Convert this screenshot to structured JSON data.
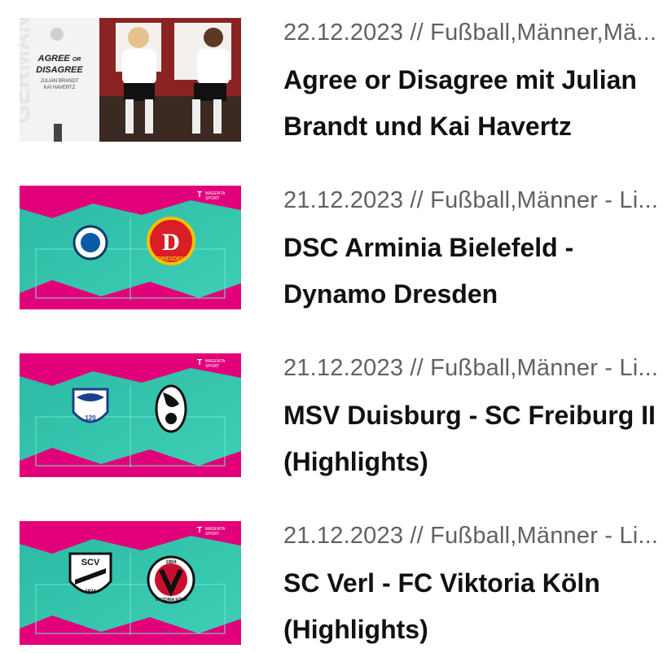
{
  "articles": [
    {
      "meta": "22.12.2023 // Fußball,Männer,Mä...",
      "title": "Agree or Disagree mit Julian Brandt und Kai Havertz",
      "thumb": {
        "type": "photo",
        "line1": "AGREE",
        "line1_small": "OR",
        "line2": "DISAGREE",
        "names1": "JULIAN BRANDT",
        "names2": "KAI HAVERTZ"
      }
    },
    {
      "meta": "21.12.2023 // Fußball,Männer - Li...",
      "title": "DSC Arminia Bielefeld - Dynamo Dresden",
      "thumb": {
        "type": "magenta",
        "brand1": "MAGENTA",
        "brand2": "SPORT",
        "right_logo_text": "DRESDEN",
        "right_logo_letter": "D"
      }
    },
    {
      "meta": "21.12.2023 // Fußball,Männer - Li...",
      "title": "MSV Duisburg - SC Freiburg II (Highlights)",
      "thumb": {
        "type": "magenta",
        "brand1": "MAGENTA",
        "brand2": "SPORT",
        "left_logo_text": "120"
      }
    },
    {
      "meta": "21.12.2023 // Fußball,Männer - Li...",
      "title": "SC Verl - FC Viktoria Köln (Highlights)",
      "thumb": {
        "type": "magenta",
        "brand1": "MAGENTA",
        "brand2": "SPORT",
        "left_logo_text": "SCV",
        "left_logo_year": "1924",
        "right_logo_text": "1904",
        "right_logo_name": "VIKTORIA KÖLN"
      }
    }
  ]
}
